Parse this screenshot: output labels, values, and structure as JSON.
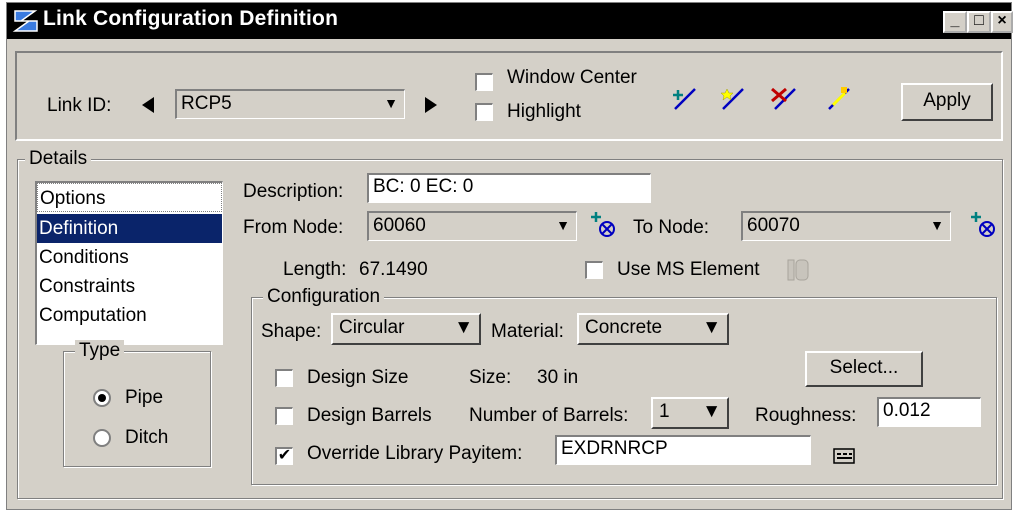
{
  "window": {
    "title": "Link Configuration Definition",
    "min_label": "_",
    "max_label": "□",
    "close_label": "×"
  },
  "toolbar": {
    "link_id_label": "Link ID:",
    "link_id_value": "RCP5",
    "window_center_label": "Window Center",
    "highlight_label": "Highlight",
    "apply_label": "Apply",
    "window_center_checked": false,
    "highlight_checked": false
  },
  "details": {
    "legend": "Details",
    "list_items": [
      "Options",
      "Definition",
      "Conditions",
      "Constraints",
      "Computation"
    ],
    "selected_index": 1,
    "type_legend": "Type",
    "type_options": [
      "Pipe",
      "Ditch"
    ],
    "type_selected": "Pipe",
    "description_label": "Description:",
    "description_value": "BC:  0  EC:  0",
    "from_node_label": "From Node:",
    "from_node_value": "60060",
    "to_node_label": "To Node:",
    "to_node_value": "60070",
    "length_label": "Length:",
    "length_value": "67.1490",
    "use_ms_element_label": "Use MS Element",
    "use_ms_element_checked": false,
    "configuration": {
      "legend": "Configuration",
      "shape_label": "Shape:",
      "shape_value": "Circular",
      "material_label": "Material:",
      "material_value": "Concrete",
      "design_size_label": "Design Size",
      "design_size_checked": false,
      "size_label": "Size:",
      "size_value": "30 in",
      "select_label": "Select...",
      "design_barrels_label": "Design Barrels",
      "design_barrels_checked": false,
      "num_barrels_label": "Number of Barrels:",
      "num_barrels_value": "1",
      "roughness_label": "Roughness:",
      "roughness_value": "0.012",
      "override_label": "Override Library Payitem:",
      "override_checked": true,
      "override_value": "EXDRNRCP"
    }
  },
  "icons": {
    "check_mark": "✔"
  }
}
